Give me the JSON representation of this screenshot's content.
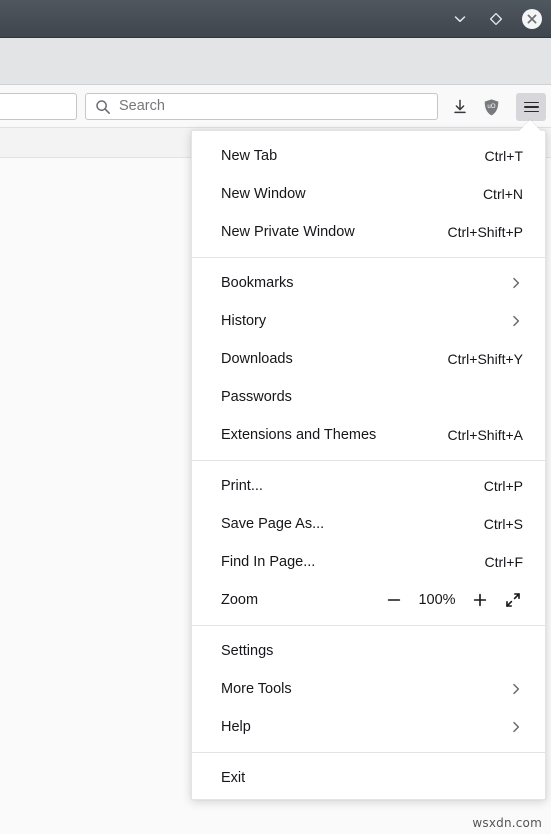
{
  "window": {
    "controls": [
      {
        "name": "minimize",
        "icon": "chevron-down-icon",
        "label": "Minimize"
      },
      {
        "name": "maximize",
        "icon": "diamond-icon",
        "label": "Maximize"
      },
      {
        "name": "close",
        "icon": "close-circle-icon",
        "label": "Close"
      }
    ]
  },
  "toolbar": {
    "url_value": "",
    "search": {
      "placeholder": "Search",
      "icon": "search-icon"
    },
    "icons": [
      {
        "name": "downloads-icon",
        "label": "Downloads"
      },
      {
        "name": "ublock-origin-shield-icon",
        "label": "uO"
      },
      {
        "name": "application-menu-icon",
        "label": "Open application menu"
      }
    ]
  },
  "menu": {
    "groups": [
      {
        "items": [
          {
            "label": "New Tab",
            "shortcut": "Ctrl+T",
            "submenu": false,
            "name": "menu-item-new-tab"
          },
          {
            "label": "New Window",
            "shortcut": "Ctrl+N",
            "submenu": false,
            "name": "menu-item-new-window"
          },
          {
            "label": "New Private Window",
            "shortcut": "Ctrl+Shift+P",
            "submenu": false,
            "name": "menu-item-new-private-window"
          }
        ]
      },
      {
        "items": [
          {
            "label": "Bookmarks",
            "shortcut": "",
            "submenu": true,
            "name": "menu-item-bookmarks"
          },
          {
            "label": "History",
            "shortcut": "",
            "submenu": true,
            "name": "menu-item-history"
          },
          {
            "label": "Downloads",
            "shortcut": "Ctrl+Shift+Y",
            "submenu": false,
            "name": "menu-item-downloads"
          },
          {
            "label": "Passwords",
            "shortcut": "",
            "submenu": false,
            "name": "menu-item-passwords"
          },
          {
            "label": "Extensions and Themes",
            "shortcut": "Ctrl+Shift+A",
            "submenu": false,
            "name": "menu-item-extensions-and-themes"
          }
        ]
      },
      {
        "items": [
          {
            "label": "Print...",
            "shortcut": "Ctrl+P",
            "submenu": false,
            "name": "menu-item-print"
          },
          {
            "label": "Save Page As...",
            "shortcut": "Ctrl+S",
            "submenu": false,
            "name": "menu-item-save-page-as"
          },
          {
            "label": "Find In Page...",
            "shortcut": "Ctrl+F",
            "submenu": false,
            "name": "menu-item-find-in-page"
          }
        ]
      },
      {
        "items": [
          {
            "label": "Settings",
            "shortcut": "",
            "submenu": false,
            "name": "menu-item-settings"
          },
          {
            "label": "More Tools",
            "shortcut": "",
            "submenu": true,
            "name": "menu-item-more-tools"
          },
          {
            "label": "Help",
            "shortcut": "",
            "submenu": true,
            "name": "menu-item-help"
          }
        ]
      },
      {
        "items": [
          {
            "label": "Exit",
            "shortcut": "",
            "submenu": false,
            "name": "menu-item-exit"
          }
        ]
      }
    ],
    "zoom": {
      "label": "Zoom",
      "value": "100%",
      "minus_label": "−",
      "plus_label": "+",
      "fullscreen_icon": "fullscreen-expand-icon"
    }
  },
  "watermark": "wsxdn.com",
  "colors": {
    "titlebar": "#464d55",
    "tabstrip": "#e3e4e6",
    "toolbar": "#f9f9fa",
    "menu_bg": "#ffffff",
    "text": "#16161a",
    "placeholder": "#77777b",
    "separator": "#e3e3e5"
  }
}
